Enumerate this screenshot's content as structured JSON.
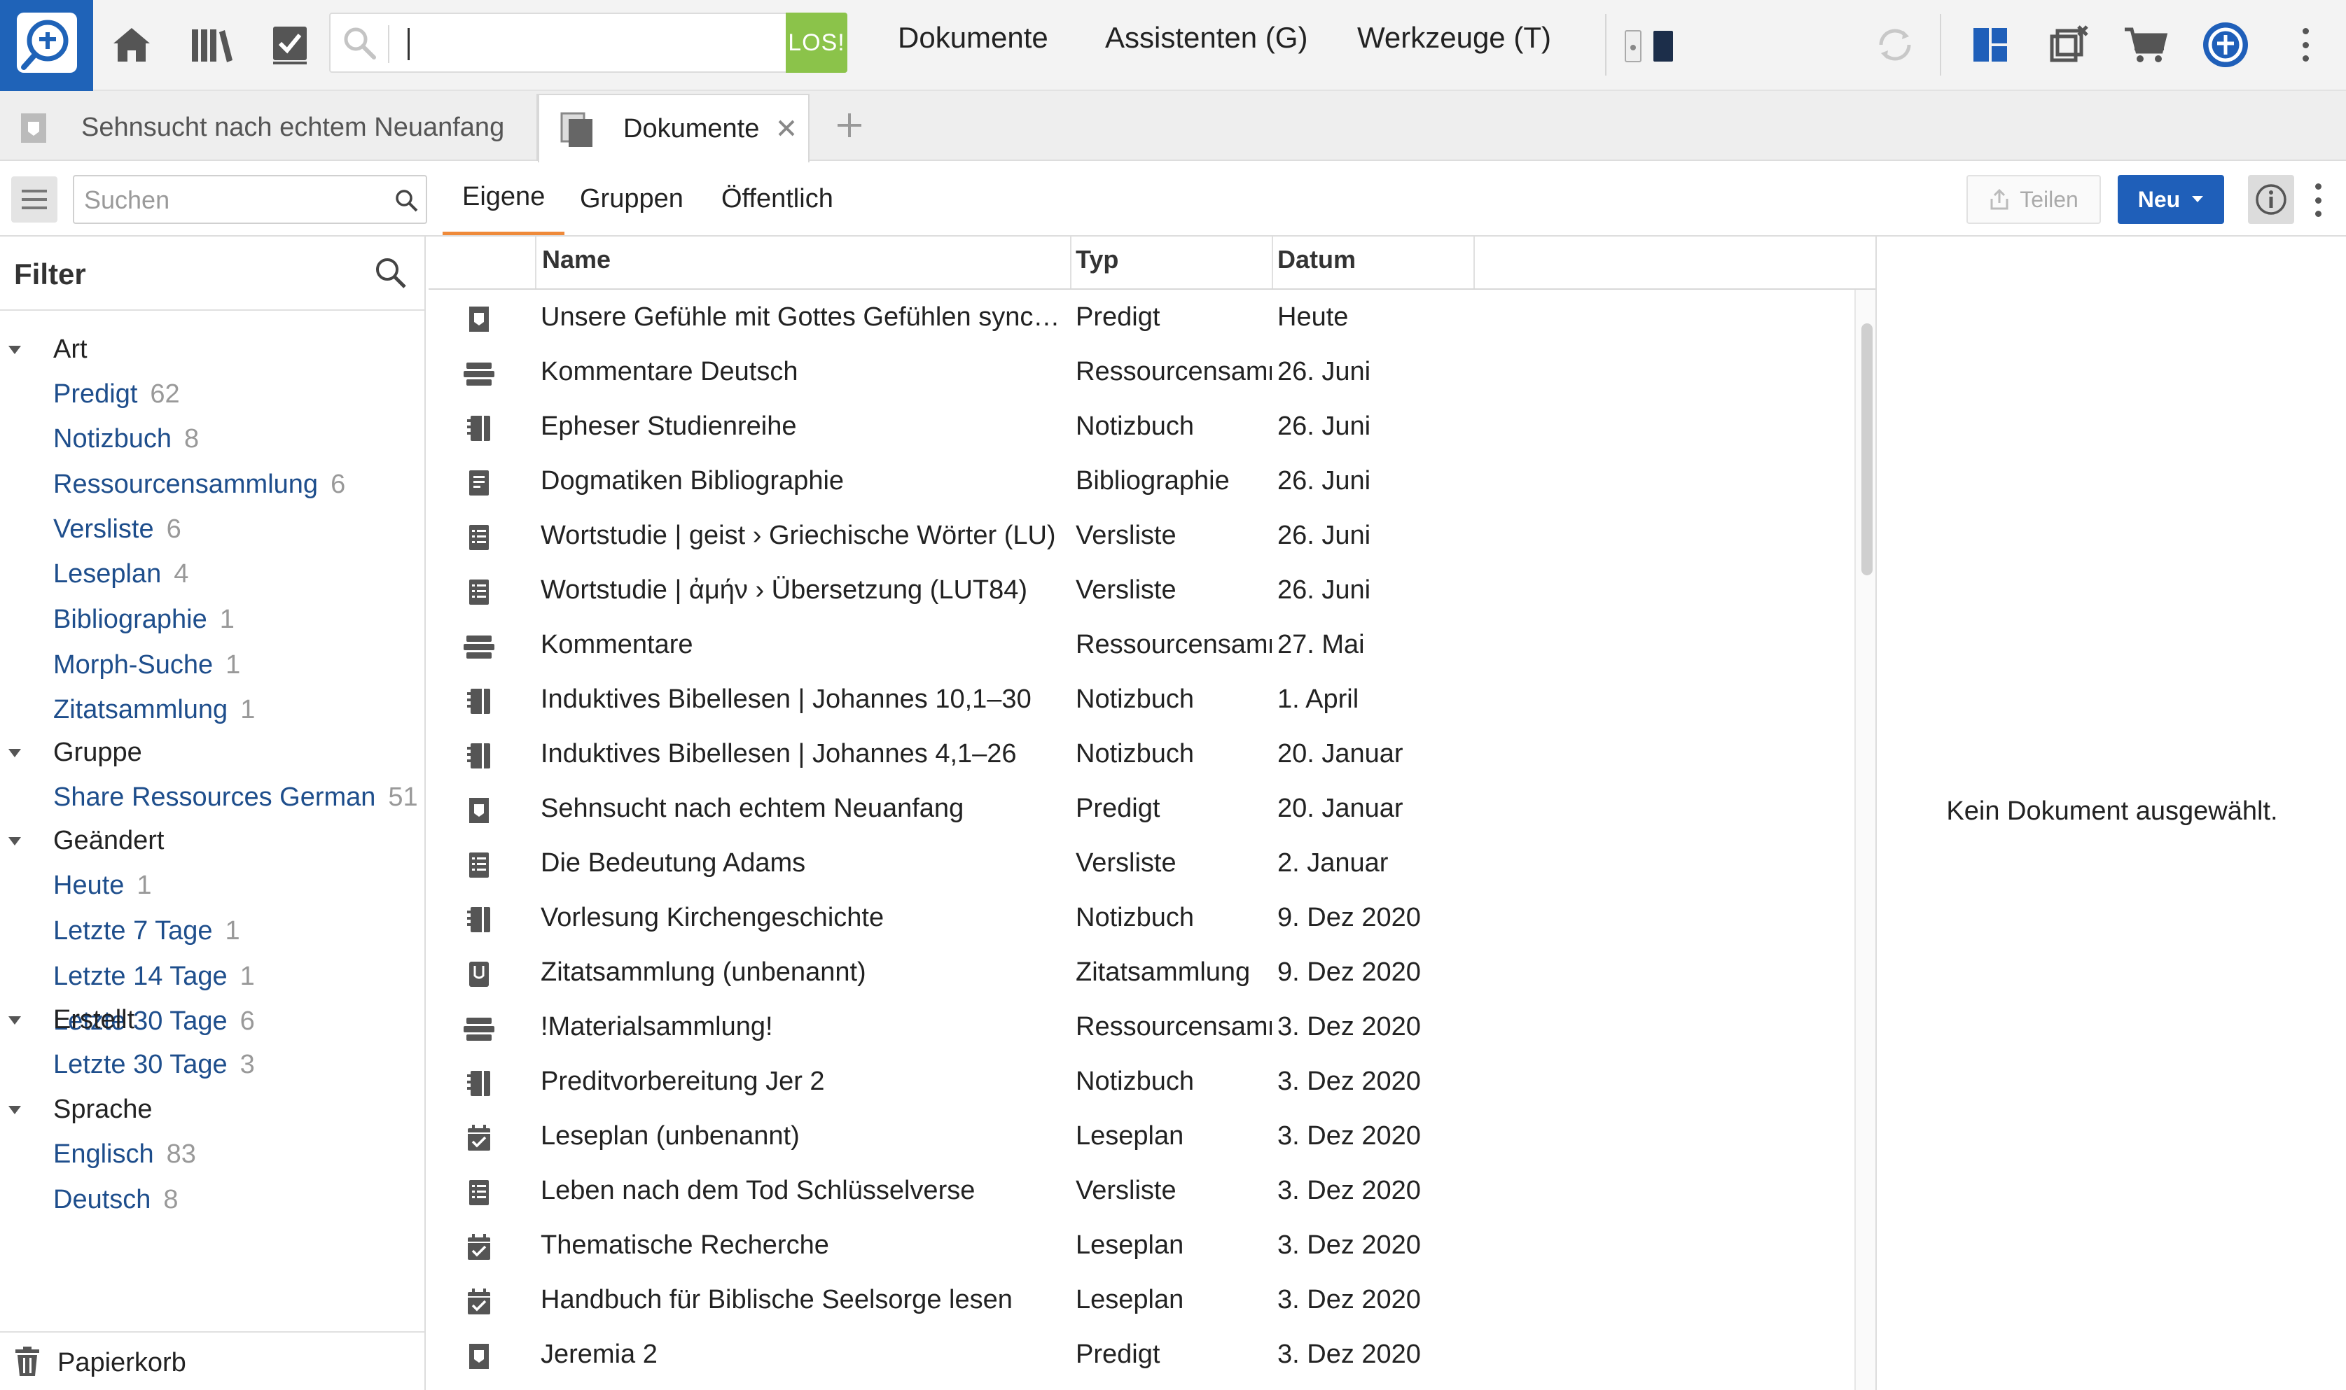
{
  "toolbar": {
    "search_value": "",
    "go_label": "LOS!",
    "menus": [
      "Dokumente",
      "Assistenten (G)",
      "Werkzeuge (T)"
    ],
    "accent": "#1f63b8",
    "go_color": "#8bc34a"
  },
  "tabs": [
    {
      "title": "Sehnsucht nach echtem Neuanfang",
      "active": false,
      "icon": "sermon-icon"
    },
    {
      "title": "Dokumente",
      "active": true,
      "icon": "documents-icon"
    }
  ],
  "subbar": {
    "search_placeholder": "Suchen",
    "tabs": [
      "Eigene",
      "Gruppen",
      "Öffentlich"
    ],
    "active_tab": "Eigene",
    "share_label": "Teilen",
    "new_label": "Neu"
  },
  "sidebar": {
    "title": "Filter",
    "groups": [
      {
        "title": "Art",
        "items": [
          {
            "label": "Predigt",
            "count": "62"
          },
          {
            "label": "Notizbuch",
            "count": "8"
          },
          {
            "label": "Ressourcensammlung",
            "count": "6"
          },
          {
            "label": "Versliste",
            "count": "6"
          },
          {
            "label": "Leseplan",
            "count": "4"
          },
          {
            "label": "Bibliographie",
            "count": "1"
          },
          {
            "label": "Morph-Suche",
            "count": "1"
          },
          {
            "label": "Zitatsammlung",
            "count": "1"
          }
        ]
      },
      {
        "title": "Gruppe",
        "items": [
          {
            "label": "Share Ressources German",
            "count": "51"
          }
        ]
      },
      {
        "title": "Geändert",
        "items": [
          {
            "label": "Heute",
            "count": "1"
          },
          {
            "label": "Letzte 7 Tage",
            "count": "1"
          },
          {
            "label": "Letzte 14 Tage",
            "count": "1"
          },
          {
            "label": "Letzte 30 Tage",
            "count": "6"
          }
        ]
      },
      {
        "title": "Erstellt",
        "items": [
          {
            "label": "Letzte 30 Tage",
            "count": "3"
          }
        ]
      },
      {
        "title": "Sprache",
        "items": [
          {
            "label": "Englisch",
            "count": "83"
          },
          {
            "label": "Deutsch",
            "count": "8"
          }
        ]
      }
    ],
    "trash_label": "Papierkorb"
  },
  "list": {
    "columns": {
      "name": "Name",
      "type": "Typ",
      "date": "Datum"
    },
    "rows": [
      {
        "icon": "sermon-icon",
        "name": "Unsere Gefühle mit Gottes Gefühlen synchr…",
        "type": "Predigt",
        "date": "Heute"
      },
      {
        "icon": "collection-icon",
        "name": "Kommentare Deutsch",
        "type": "Ressourcensamn",
        "date": "26. Juni"
      },
      {
        "icon": "notebook-icon",
        "name": "Epheser Studienreihe",
        "type": "Notizbuch",
        "date": "26. Juni"
      },
      {
        "icon": "bibliography-icon",
        "name": "Dogmatiken Bibliographie",
        "type": "Bibliographie",
        "date": "26. Juni"
      },
      {
        "icon": "verselist-icon",
        "name": "Wortstudie | geist › Griechische Wörter (LU)",
        "type": "Versliste",
        "date": "26. Juni"
      },
      {
        "icon": "verselist-icon",
        "name": "Wortstudie | ἀμήν › Übersetzung (LUT84)",
        "type": "Versliste",
        "date": "26. Juni"
      },
      {
        "icon": "collection-icon",
        "name": "Kommentare",
        "type": "Ressourcensamn",
        "date": "27. Mai"
      },
      {
        "icon": "notebook-icon",
        "name": "Induktives Bibellesen | Johannes 10,1–30",
        "type": "Notizbuch",
        "date": "1. April"
      },
      {
        "icon": "notebook-icon",
        "name": "Induktives Bibellesen | Johannes 4,1–26",
        "type": "Notizbuch",
        "date": "20. Januar"
      },
      {
        "icon": "sermon-icon",
        "name": "Sehnsucht nach echtem Neuanfang",
        "type": "Predigt",
        "date": "20. Januar"
      },
      {
        "icon": "verselist-icon",
        "name": "Die Bedeutung Adams",
        "type": "Versliste",
        "date": "2. Januar"
      },
      {
        "icon": "notebook-icon",
        "name": "Vorlesung Kirchengeschichte",
        "type": "Notizbuch",
        "date": "9. Dez 2020"
      },
      {
        "icon": "quote-collection-icon",
        "name": "Zitatsammlung (unbenannt)",
        "type": "Zitatsammlung",
        "date": "9. Dez 2020"
      },
      {
        "icon": "collection-icon",
        "name": "!Materialsammlung!",
        "type": "Ressourcensamn",
        "date": "3. Dez 2020"
      },
      {
        "icon": "notebook-icon",
        "name": "Preditvorbereitung Jer 2",
        "type": "Notizbuch",
        "date": "3. Dez 2020"
      },
      {
        "icon": "reading-plan-icon",
        "name": "Leseplan (unbenannt)",
        "type": "Leseplan",
        "date": "3. Dez 2020"
      },
      {
        "icon": "verselist-icon",
        "name": "Leben nach dem Tod Schlüsselverse",
        "type": "Versliste",
        "date": "3. Dez 2020"
      },
      {
        "icon": "reading-plan-icon",
        "name": "Thematische Recherche",
        "type": "Leseplan",
        "date": "3. Dez 2020"
      },
      {
        "icon": "reading-plan-icon",
        "name": "Handbuch für Biblische Seelsorge lesen",
        "type": "Leseplan",
        "date": "3. Dez 2020"
      },
      {
        "icon": "sermon-icon",
        "name": "Jeremia 2",
        "type": "Predigt",
        "date": "3. Dez 2020"
      }
    ]
  },
  "panel": {
    "empty_text": "Kein Dokument ausgewählt."
  }
}
